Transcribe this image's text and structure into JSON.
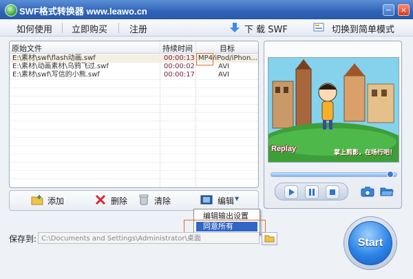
{
  "window": {
    "title": "SWF格式转换器 www.leawo.cn",
    "minimize": "−",
    "close": "×"
  },
  "menu": {
    "items": [
      "如何使用",
      "立即购买",
      "注册"
    ],
    "download": "下 载 SWF",
    "switch_mode": "切换到简单模式"
  },
  "list": {
    "headers": {
      "file": "原始文件",
      "duration": "持续时间",
      "target": "目标"
    },
    "rows": [
      {
        "file": "E:\\素材\\swf\\flash动画.swf",
        "duration": "00:00:13",
        "target": "MP4/iPod/iPhon..."
      },
      {
        "file": "E:\\素材\\动画素材\\乌鸦飞过.swf",
        "duration": "00:00:02",
        "target": "AVI"
      },
      {
        "file": "E:\\素材\\swf\\写信的小熊.swf",
        "duration": "00:00:17",
        "target": "AVI"
      }
    ]
  },
  "actions": {
    "add": "添加",
    "delete": "删除",
    "clear": "清除",
    "edit": "编辑"
  },
  "dropdown": {
    "items": [
      "编辑输出设置",
      "同意所有"
    ],
    "highlighted_index": 1
  },
  "preview": {
    "replay": "Replay",
    "caption": "掌上剪影，在场行吧！",
    "seek_position": 0.97
  },
  "save": {
    "label": "保存到:",
    "path": "C:\\Documents and Settings\\Administrator\\桌面"
  },
  "start": "Start",
  "colors": {
    "title_bar": "#2f63b8",
    "highlight": "#3166c4",
    "callout": "#e06a2a",
    "duration_text": "#7a1b3a"
  }
}
